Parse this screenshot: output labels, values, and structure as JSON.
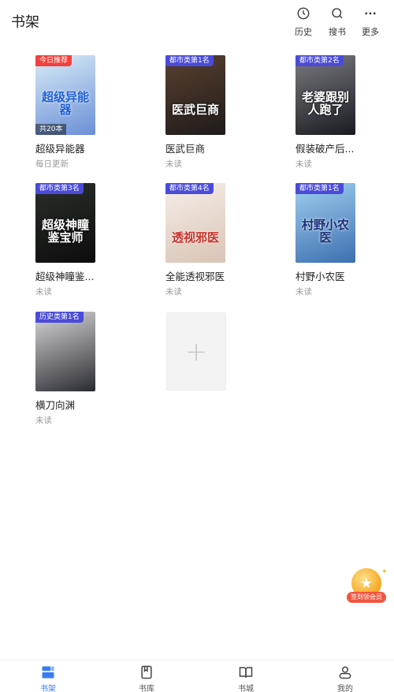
{
  "header": {
    "title": "书架",
    "actions": [
      {
        "label": "历史",
        "icon": "clock-icon"
      },
      {
        "label": "搜书",
        "icon": "search-icon"
      },
      {
        "label": "更多",
        "icon": "more-dots-icon"
      }
    ]
  },
  "books": [
    {
      "title": "超级异能器",
      "status": "每日更新",
      "badge": "今日推荐",
      "badge_color": "#f0413a",
      "cover_text": "超级异能器",
      "count": "共20本",
      "cover_colors": [
        "#d9ecf7",
        "#6a8fd6"
      ]
    },
    {
      "title": "医武巨商",
      "status": "未读",
      "badge": "都市类第1名",
      "badge_color": "#4a4bd8",
      "cover_text": "医武巨商",
      "cover_colors": [
        "#5a4030",
        "#1e1b1a"
      ]
    },
    {
      "title": "假装破产后...",
      "status": "未读",
      "badge": "都市类第2名",
      "badge_color": "#4a4bd8",
      "cover_text": "老婆跟别人跑了",
      "cover_colors": [
        "#7a7a80",
        "#1a1a22"
      ]
    },
    {
      "title": "超级神瞳鉴...",
      "status": "未读",
      "badge": "都市类第3名",
      "badge_color": "#4a4bd8",
      "cover_text": "超级神瞳鉴宝师",
      "cover_colors": [
        "#2a2f2a",
        "#0c0c0c"
      ]
    },
    {
      "title": "全能透视邪医",
      "status": "未读",
      "badge": "都市类第4名",
      "badge_color": "#4a4bd8",
      "cover_text": "透视邪医",
      "cover_colors": [
        "#f6eee8",
        "#d9c4b6"
      ]
    },
    {
      "title": "村野小农医",
      "status": "未读",
      "badge": "都市类第1名",
      "badge_color": "#4a4bd8",
      "cover_text": "村野小农医",
      "cover_colors": [
        "#9fd0f0",
        "#3d6fb0"
      ]
    },
    {
      "title": "横刀向渊",
      "status": "未读",
      "badge": "历史类第1名",
      "badge_color": "#4a4bd8",
      "cover_text": "",
      "cover_colors": [
        "#d9d9d9",
        "#2a2a32"
      ]
    }
  ],
  "add_slot": {
    "symbol": "+"
  },
  "vip_float": {
    "label": "签到领会员",
    "icon": "star-coin-icon",
    "colors": {
      "pill": "#f2553f",
      "coin": "#f6a623"
    }
  },
  "tabs": [
    {
      "label": "书架",
      "icon": "bookshelf-icon",
      "active": true
    },
    {
      "label": "书库",
      "icon": "book-library-icon",
      "active": false
    },
    {
      "label": "书城",
      "icon": "open-book-icon",
      "active": false
    },
    {
      "label": "我的",
      "icon": "person-icon",
      "active": false
    }
  ],
  "colors": {
    "accent": "#3a7bf0",
    "muted": "#999999"
  }
}
